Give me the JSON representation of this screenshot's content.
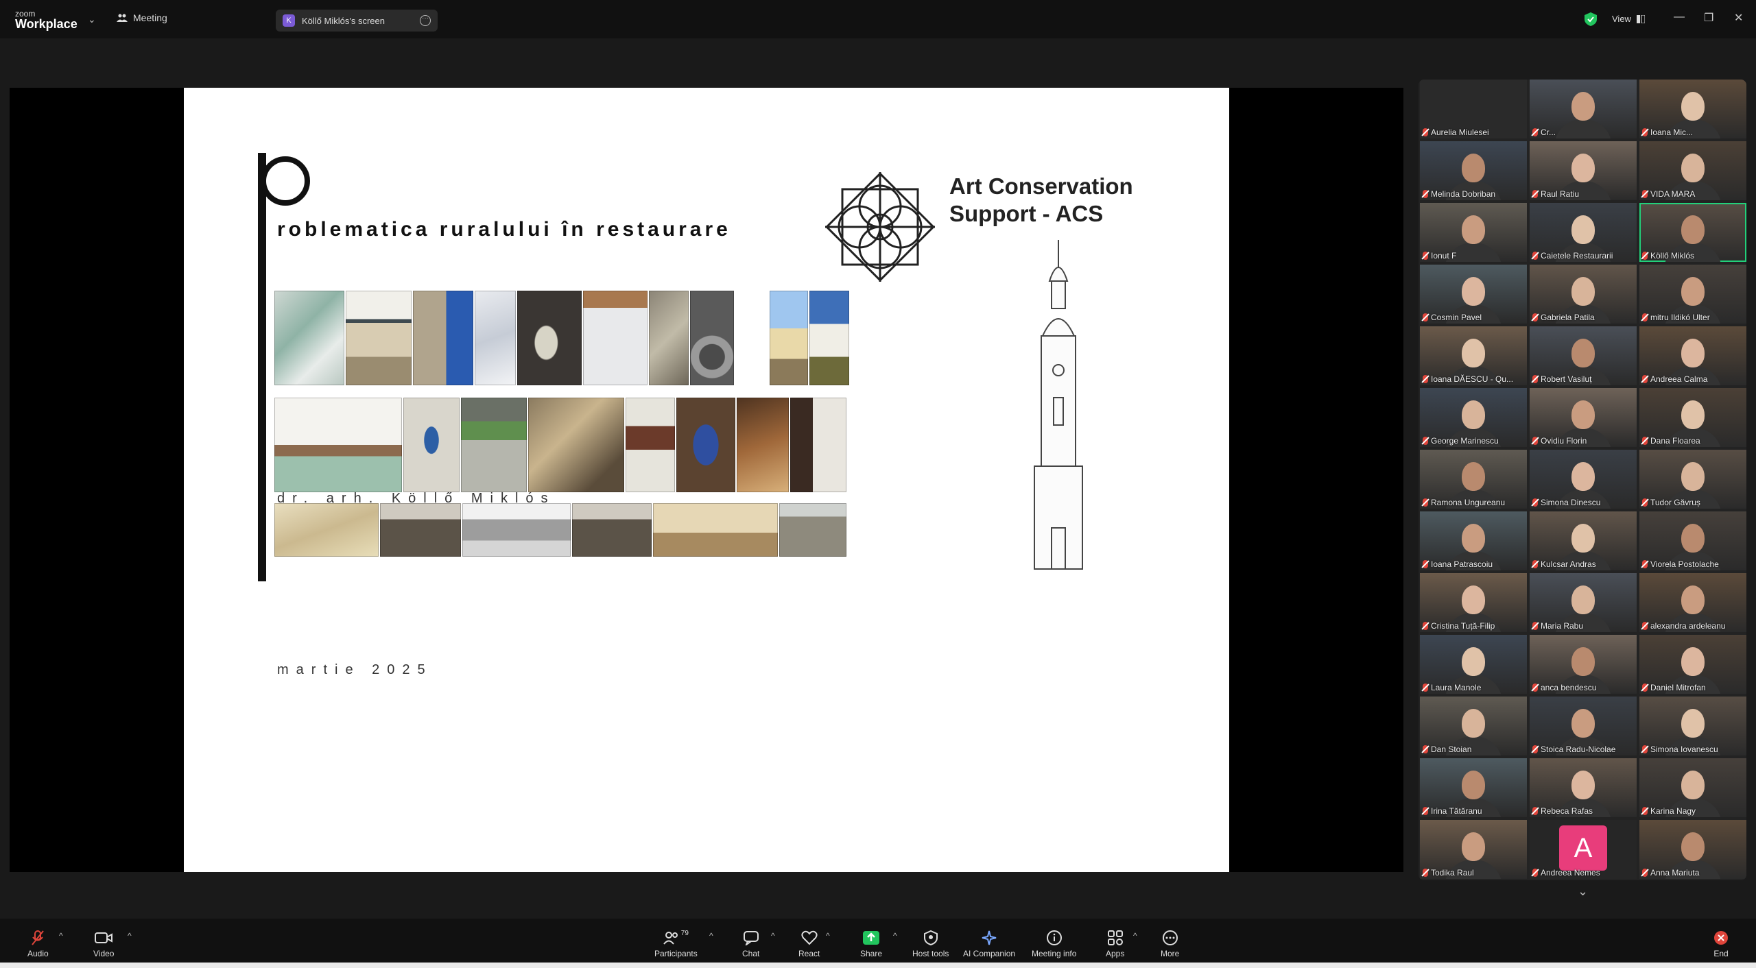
{
  "app": {
    "brand_small": "zoom",
    "brand_big": "Workplace"
  },
  "header": {
    "meeting_label": "Meeting",
    "share_pill": {
      "initial": "K",
      "label": "Köllő Miklós's screen"
    },
    "view_label": "View"
  },
  "slide": {
    "title": "roblematica ruralului în restaurare",
    "title_initial": "p",
    "org_line1": "Art Conservation",
    "org_line2": "Support - ACS",
    "author": "dr. arh. Köllő Miklós",
    "date": "martie 2025"
  },
  "participants": [
    {
      "name": "Aurelia Miulesei"
    },
    {
      "name": "Cr..."
    },
    {
      "name": "Ioana Mic..."
    },
    {
      "name": "Melinda Dobriban"
    },
    {
      "name": "Raul Ratiu"
    },
    {
      "name": "VIDA MARA"
    },
    {
      "name": "Ionut F"
    },
    {
      "name": "Caietele Restaurarii"
    },
    {
      "name": "Köllő Miklós"
    },
    {
      "name": "Cosmin Pavel"
    },
    {
      "name": "Gabriela Patila"
    },
    {
      "name": "mitru Ildikó Ulter"
    },
    {
      "name": "Ioana DĂESCU - Qu..."
    },
    {
      "name": "Robert Vasiluț"
    },
    {
      "name": "Andreea Calma"
    },
    {
      "name": "George Marinescu"
    },
    {
      "name": "Ovidiu Florin"
    },
    {
      "name": "Dana Floarea"
    },
    {
      "name": "Ramona Ungureanu"
    },
    {
      "name": "Simona Dinescu"
    },
    {
      "name": "Tudor Găvruș"
    },
    {
      "name": "Ioana Patrascoiu"
    },
    {
      "name": "Kulcsar Andras"
    },
    {
      "name": "Viorela Postolache"
    },
    {
      "name": "Cristina Tuță-Filip"
    },
    {
      "name": "Maria Rabu"
    },
    {
      "name": "alexandra ardeleanu"
    },
    {
      "name": "Laura Manole"
    },
    {
      "name": "anca bendescu"
    },
    {
      "name": "Daniel Mitrofan"
    },
    {
      "name": "Dan Stoian"
    },
    {
      "name": "Stoica Radu-Nicolae"
    },
    {
      "name": "Simona Iovanescu"
    },
    {
      "name": "Irina Tătăranu"
    },
    {
      "name": "Rebeca Rafas"
    },
    {
      "name": "Karina Nagy"
    },
    {
      "name": "Todika Raul"
    },
    {
      "name": "Andreea Nemes",
      "avatar_letter": "A"
    },
    {
      "name": "Anna Mariuta"
    }
  ],
  "toolbar": {
    "audio": "Audio",
    "video": "Video",
    "participants": "Participants",
    "participants_count": "79",
    "chat": "Chat",
    "react": "React",
    "share": "Share",
    "host_tools": "Host tools",
    "ai_companion": "AI Companion",
    "meeting_info": "Meeting info",
    "apps": "Apps",
    "more": "More",
    "end": "End"
  },
  "colors": {
    "accent_green": "#22d07a",
    "end_red": "#e0453b",
    "share_green": "#22c55e",
    "avatar_pink": "#e83d7b"
  }
}
